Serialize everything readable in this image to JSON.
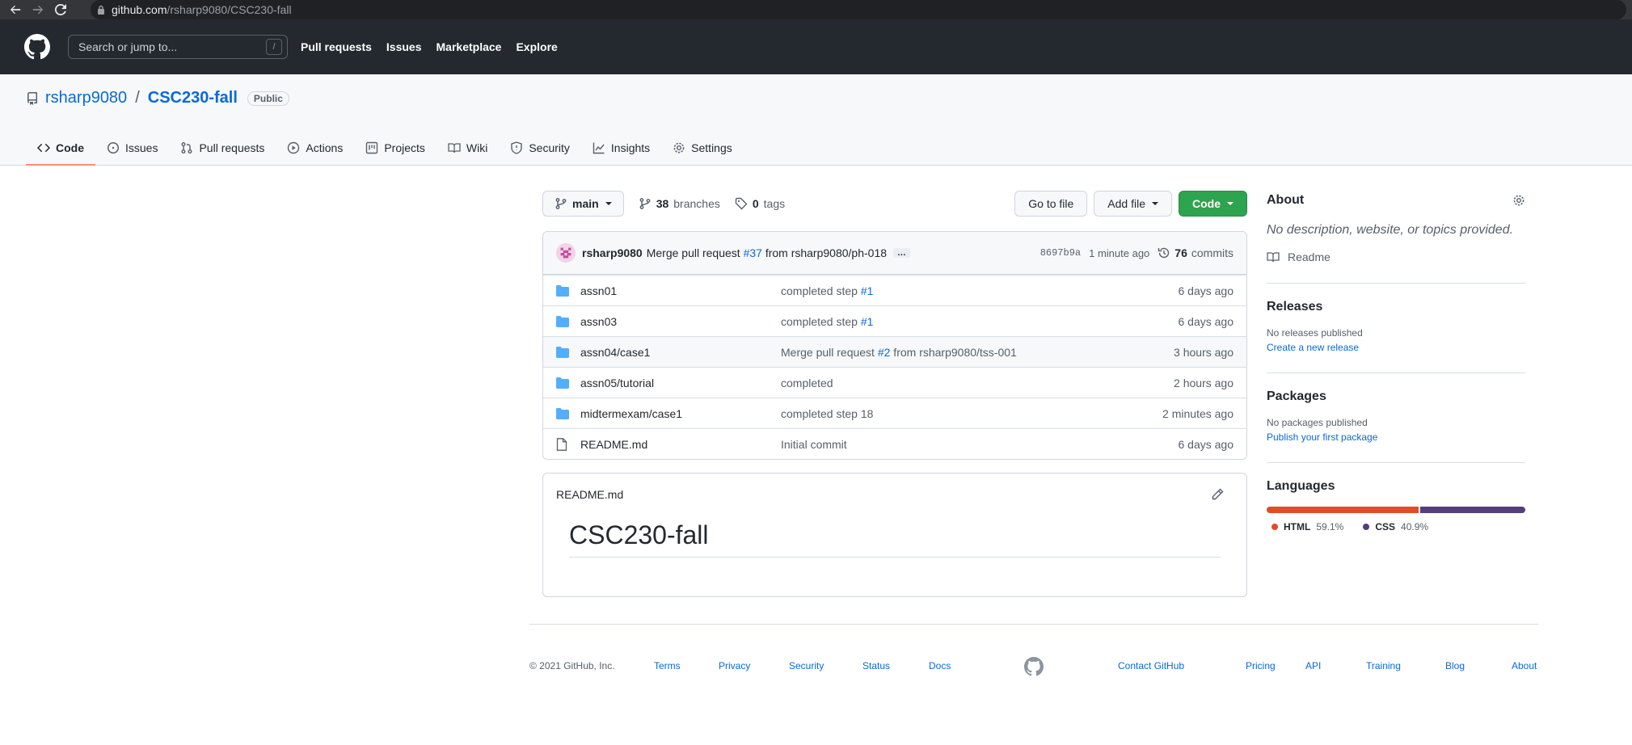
{
  "browser": {
    "url_domain": "github.com",
    "url_path": "/rsharp9080/CSC230-fall"
  },
  "header": {
    "search_placeholder": "Search or jump to...",
    "search_shortcut": "/",
    "nav": [
      "Pull requests",
      "Issues",
      "Marketplace",
      "Explore"
    ]
  },
  "repo": {
    "owner": "rsharp9080",
    "separator": "/",
    "name": "CSC230-fall",
    "visibility": "Public",
    "tabs": [
      {
        "label": "Code",
        "icon": "code-icon"
      },
      {
        "label": "Issues",
        "icon": "issue-icon"
      },
      {
        "label": "Pull requests",
        "icon": "pull-request-icon"
      },
      {
        "label": "Actions",
        "icon": "play-icon"
      },
      {
        "label": "Projects",
        "icon": "project-icon"
      },
      {
        "label": "Wiki",
        "icon": "book-icon"
      },
      {
        "label": "Security",
        "icon": "shield-icon"
      },
      {
        "label": "Insights",
        "icon": "graph-icon"
      },
      {
        "label": "Settings",
        "icon": "gear-icon"
      }
    ]
  },
  "toolbar": {
    "branch": "main",
    "branches_count": "38",
    "branches_label": "branches",
    "tags_count": "0",
    "tags_label": "tags",
    "go_to_file": "Go to file",
    "add_file": "Add file",
    "code": "Code"
  },
  "latest_commit": {
    "author": "rsharp9080",
    "message_prefix": "Merge pull request",
    "pr_link": "#37",
    "message_suffix": "from rsharp9080/ph-018",
    "ellipsis": "…",
    "sha": "8697b9a",
    "time": "1 minute ago",
    "commits_count": "76",
    "commits_label": "commits"
  },
  "files": [
    {
      "type": "dir",
      "name": "assn01",
      "msg": "completed step ",
      "link": "#1",
      "msg_after": "",
      "age": "6 days ago"
    },
    {
      "type": "dir",
      "name": "assn03",
      "msg": "completed step ",
      "link": "#1",
      "msg_after": "",
      "age": "6 days ago"
    },
    {
      "type": "dir",
      "name": "assn04/case1",
      "msg": "Merge pull request ",
      "link": "#2",
      "msg_after": " from rsharp9080/tss-001",
      "age": "3 hours ago"
    },
    {
      "type": "dir",
      "name": "assn05/tutorial",
      "msg": "completed",
      "link": "",
      "msg_after": "",
      "age": "2 hours ago"
    },
    {
      "type": "dir",
      "name": "midtermexam/case1",
      "msg": "completed step 18",
      "link": "",
      "msg_after": "",
      "age": "2 minutes ago"
    },
    {
      "type": "file",
      "name": "README.md",
      "msg": "Initial commit",
      "link": "",
      "msg_after": "",
      "age": "6 days ago"
    }
  ],
  "readme": {
    "filename": "README.md",
    "heading": "CSC230-fall"
  },
  "sidebar": {
    "about_title": "About",
    "about_desc": "No description, website, or topics provided.",
    "readme_label": "Readme",
    "releases_title": "Releases",
    "releases_none": "No releases published",
    "releases_link": "Create a new release",
    "packages_title": "Packages",
    "packages_none": "No packages published",
    "packages_link": "Publish your first package",
    "languages_title": "Languages",
    "languages": [
      {
        "name": "HTML",
        "percent": "59.1%",
        "value": 59.1,
        "color": "#e34c26"
      },
      {
        "name": "CSS",
        "percent": "40.9%",
        "value": 40.9,
        "color": "#563d7c"
      }
    ]
  },
  "footer": {
    "copyright": "© 2021 GitHub, Inc.",
    "links_left": [
      "Terms",
      "Privacy",
      "Security",
      "Status",
      "Docs"
    ],
    "links_right": [
      "Contact GitHub",
      "Pricing",
      "API",
      "Training",
      "Blog",
      "About"
    ]
  },
  "colors": {
    "accent_link": "#0969da",
    "tab_underline": "#fd8c73",
    "code_button": "#2da44e",
    "folder": "#54aeff"
  }
}
